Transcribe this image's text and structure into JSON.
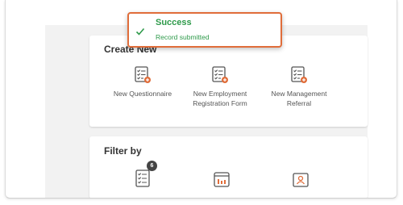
{
  "toast": {
    "title": "Success",
    "message": "Record submitted"
  },
  "create_new": {
    "title": "Create New",
    "items": [
      {
        "label": "New Questionnaire",
        "icon": "checklist-add-icon"
      },
      {
        "label": "New Employment Registration Form",
        "icon": "checklist-add-icon"
      },
      {
        "label": "New Management Referral",
        "icon": "checklist-add-icon"
      }
    ]
  },
  "filter_by": {
    "title": "Filter by",
    "items": [
      {
        "icon": "checklist-icon",
        "badge": "6"
      },
      {
        "icon": "dashboard-icon"
      },
      {
        "icon": "person-folder-icon"
      }
    ]
  },
  "colors": {
    "accent": "#e06d3a",
    "success": "#2e9a4a",
    "text": "#333333"
  }
}
